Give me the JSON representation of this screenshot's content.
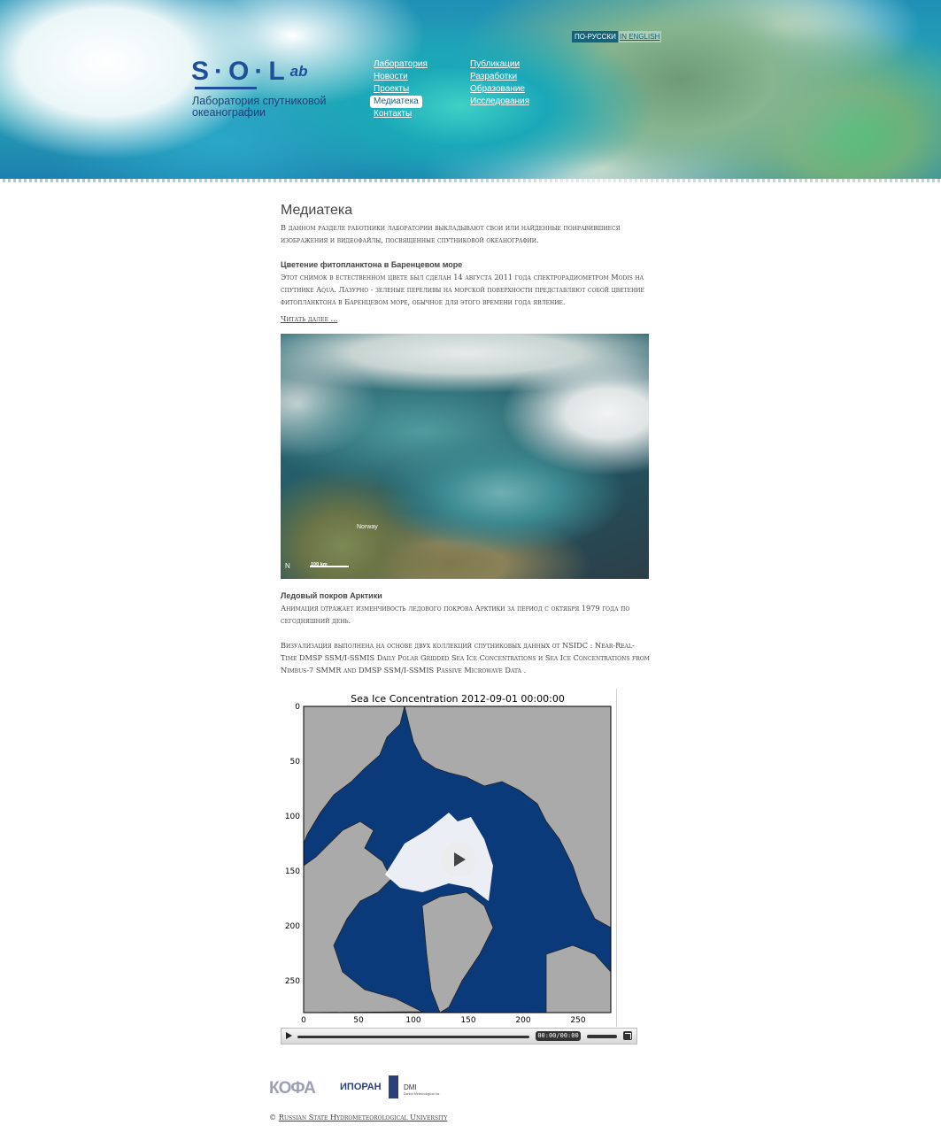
{
  "header": {
    "logo": {
      "mark": "S·O·L",
      "suffix": "ab",
      "line1": "Лаборатория спутниковой",
      "line2": "океанографии"
    },
    "lang": {
      "ru": "по-русски",
      "en": "in english"
    },
    "nav_left": [
      "Лаборатория",
      "Новости",
      "Проекты",
      "Медиатека",
      "Контакты"
    ],
    "nav_right": [
      "Публикации",
      "Разработки",
      "Образование",
      "Исследования"
    ],
    "active_nav": "Медиатека"
  },
  "main": {
    "title": "Медиатека",
    "intro": "В данном разделе работники лаборатории выкладывают свои или найденные понравившиеся изображения и видеофайлы, посвященные спутниковой океанографии.",
    "item1": {
      "title": "Цветение фитопланктона в Баренцевом море",
      "text": "Этот снимок в естественном цвете был сделан 14 августа 2011 года спектрорадиометром Modis на спутнике Aqua. Лазурно - зеленые переливы на морской поверхности представляют собой цветение фитопланктона в Баренцевом море, обычное для этого времени года явление.",
      "more": "Читать далее ...",
      "image_label": "Norway",
      "scale": "100 km",
      "north": "N"
    },
    "item2": {
      "title": "Ледовый покров Арктики",
      "text1": "Анимация отражает изменчивость ледового покрова Арктики за период с октября 1979 года по сегодняшний день.",
      "text2": "Визуализация выполнена на основе двух коллекций спутниковых данных от NSIDC : Near-Real-Time DMSP SSM/I-SSMIS Daily Polar Gridded Sea Ice Concentrations  и Sea Ice Concentrations from Nimbus-7 SMMR and DMSP SSM/I-SSMIS Passive Microwave Data ."
    }
  },
  "video": {
    "plot_title": "Sea Ice Concentration 2012-09-01 00:00:00",
    "y_ticks": [
      "0",
      "50",
      "100",
      "150",
      "200",
      "250"
    ],
    "x_ticks": [
      "0",
      "50",
      "100",
      "150",
      "200",
      "250"
    ],
    "time": "00:00/00:00",
    "volume": 0.75,
    "colors": {
      "ocean": "#0a3a7a",
      "land": "#aaaaaa",
      "ice": "#ffffff"
    }
  },
  "footer": {
    "logos": [
      "КОФА",
      "ИПОРАН",
      "DMI"
    ],
    "dmi_sub": "Danish Meteorological Ins.",
    "copyright_symbol": "©",
    "copyright_link": "Russian State Hydrometeorological University"
  }
}
